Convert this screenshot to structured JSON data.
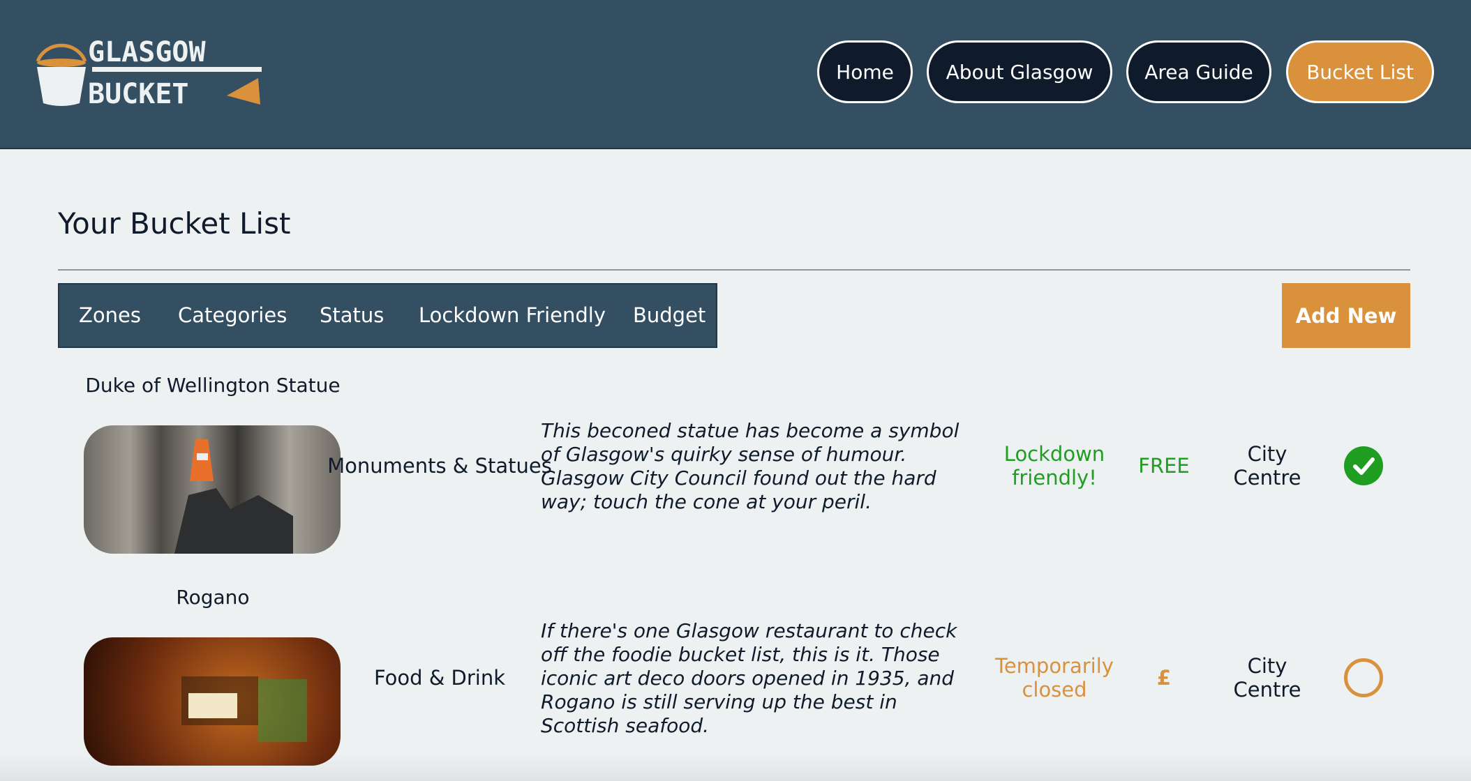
{
  "header": {
    "logo_text_top": "GLASGOW",
    "logo_text_bottom": "BUCKET",
    "nav": [
      {
        "label": "Home"
      },
      {
        "label": "About Glasgow"
      },
      {
        "label": "Area Guide"
      },
      {
        "label": "Bucket List",
        "active": true
      }
    ]
  },
  "page_title": "Your Bucket List",
  "filters": [
    "Zones",
    "Categories",
    "Status",
    "Lockdown Friendly",
    "Budget"
  ],
  "add_new_label": "Add New",
  "colors": {
    "header": "#344f62",
    "accent": "#d9913c",
    "green": "#1f9e22"
  },
  "items": [
    {
      "title": "Duke of Wellington Statue",
      "category": "Monuments & Statues",
      "description": "This beconed statue has become a symbol of Glasgow's quirky sense of humour. Glasgow City Council found out the hard way; touch the cone at your peril.",
      "status": "Lockdown friendly!",
      "budget": "FREE",
      "zone": "City Centre",
      "completed": true
    },
    {
      "title": "Rogano",
      "category": "Food & Drink",
      "description": "If there's one Glasgow restaurant to check off the foodie bucket list, this is it. Those iconic art deco doors opened in 1935, and Rogano is still serving up the best in Scottish seafood.",
      "status": "Temporarily closed",
      "budget": "£",
      "zone": "City Centre",
      "completed": false
    }
  ]
}
